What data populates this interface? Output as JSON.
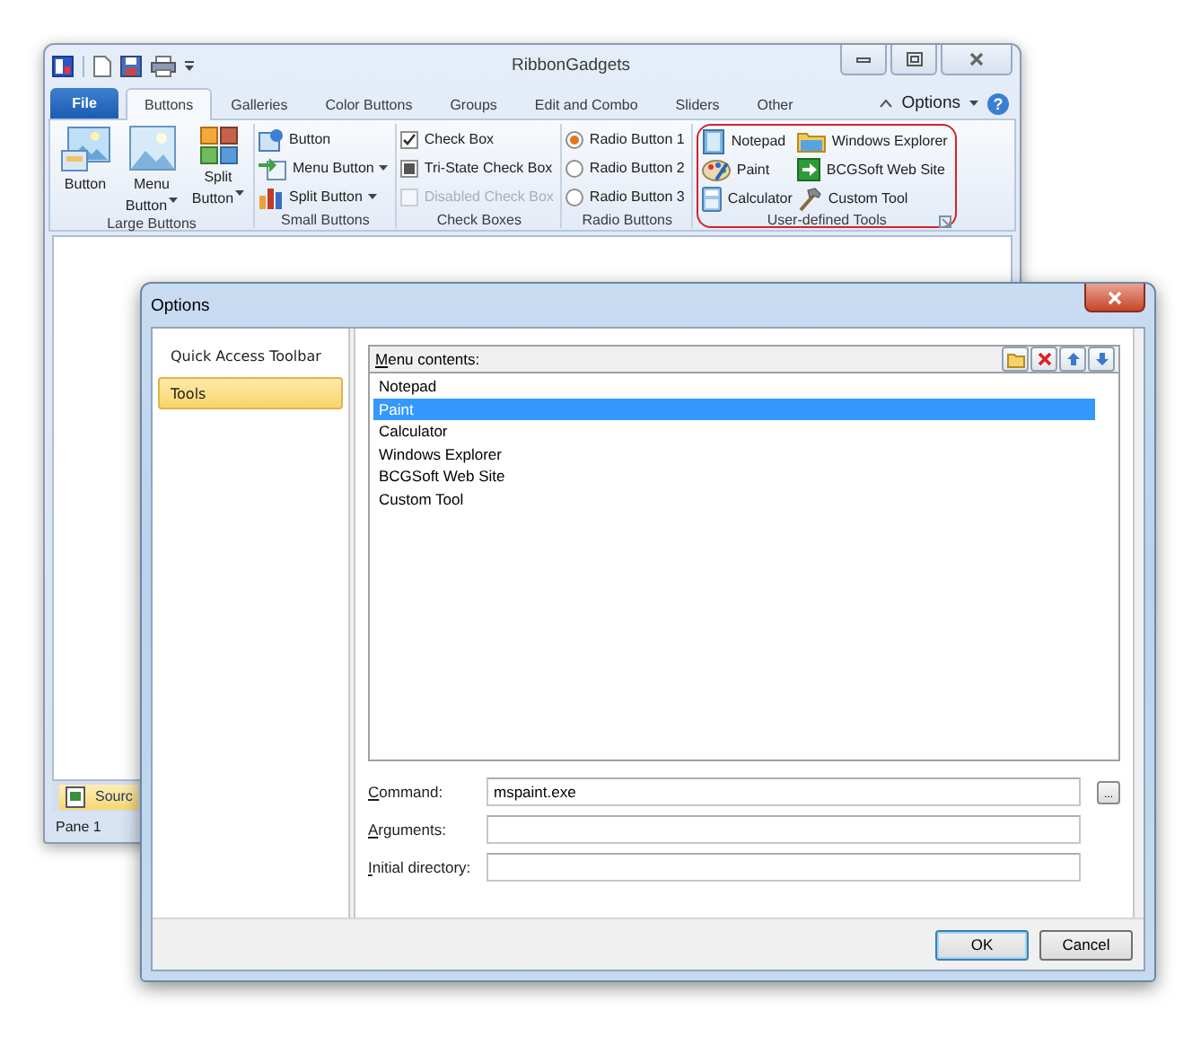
{
  "main_window": {
    "title": "RibbonGadgets",
    "tabs": [
      {
        "label": "File",
        "kind": "file",
        "selected": false
      },
      {
        "label": "Buttons",
        "kind": "tab",
        "selected": true
      },
      {
        "label": "Galleries",
        "kind": "tab",
        "selected": false
      },
      {
        "label": "Color Buttons",
        "kind": "tab",
        "selected": false
      },
      {
        "label": "Groups",
        "kind": "tab",
        "selected": false
      },
      {
        "label": "Edit and Combo",
        "kind": "tab",
        "selected": false
      },
      {
        "label": "Sliders",
        "kind": "tab",
        "selected": false
      },
      {
        "label": "Other",
        "kind": "tab",
        "selected": false
      }
    ],
    "options_label": "Options",
    "help": "?",
    "groups": [
      {
        "kind": "large",
        "title": "Large Buttons",
        "items": [
          {
            "label": "Button",
            "dropdown": false
          },
          {
            "label": "Menu Button",
            "dropdown": true
          },
          {
            "label": "Split Button",
            "dropdown": true
          }
        ]
      },
      {
        "kind": "small",
        "title": "Small Buttons",
        "items": [
          {
            "label": "Button",
            "dropdown": false
          },
          {
            "label": "Menu Button",
            "dropdown": true
          },
          {
            "label": "Split Button",
            "dropdown": true
          }
        ]
      },
      {
        "kind": "checks",
        "title": "Check Boxes",
        "items": [
          {
            "label": "Check Box",
            "checked": true,
            "indeterminate": false,
            "disabled": false
          },
          {
            "label": "Tri-State Check Box",
            "checked": false,
            "indeterminate": true,
            "disabled": false
          },
          {
            "label": "Disabled Check Box",
            "checked": false,
            "indeterminate": false,
            "disabled": true
          }
        ]
      },
      {
        "kind": "radios",
        "title": "Radio Buttons",
        "items": [
          {
            "label": "Radio Button 1",
            "selected": true
          },
          {
            "label": "Radio Button 2",
            "selected": false
          },
          {
            "label": "Radio Button 3",
            "selected": false
          }
        ]
      },
      {
        "kind": "tools",
        "title": "User-defined Tools",
        "highlighted": true,
        "items": [
          {
            "label": "Notepad"
          },
          {
            "label": "Paint"
          },
          {
            "label": "Calculator"
          },
          {
            "label": "Windows Explorer"
          },
          {
            "label": "BCGSoft Web Site"
          },
          {
            "label": "Custom Tool"
          }
        ]
      }
    ],
    "document_tabs": [
      {
        "label": "Sourc",
        "selected": true
      }
    ],
    "status_bar": "Pane 1"
  },
  "options_dialog": {
    "title": "Options",
    "categories": [
      {
        "label": "Quick Access Toolbar",
        "selected": false
      },
      {
        "label": "Tools",
        "selected": true
      }
    ],
    "menu_contents_label": "Menu contents:",
    "menu_items": [
      {
        "label": "Notepad",
        "selected": false
      },
      {
        "label": "Paint",
        "selected": true
      },
      {
        "label": "Calculator",
        "selected": false
      },
      {
        "label": "Windows Explorer",
        "selected": false
      },
      {
        "label": "BCGSoft Web Site",
        "selected": false
      },
      {
        "label": "Custom Tool",
        "selected": false
      }
    ],
    "fields": [
      {
        "label": "Command:",
        "value": "mspaint.exe",
        "browse_label": "..."
      },
      {
        "label": "Arguments:"
      },
      {
        "label": "Initial directory:"
      }
    ],
    "buttons": [
      {
        "label": "OK",
        "default": true
      },
      {
        "label": "Cancel",
        "default": false
      }
    ]
  }
}
